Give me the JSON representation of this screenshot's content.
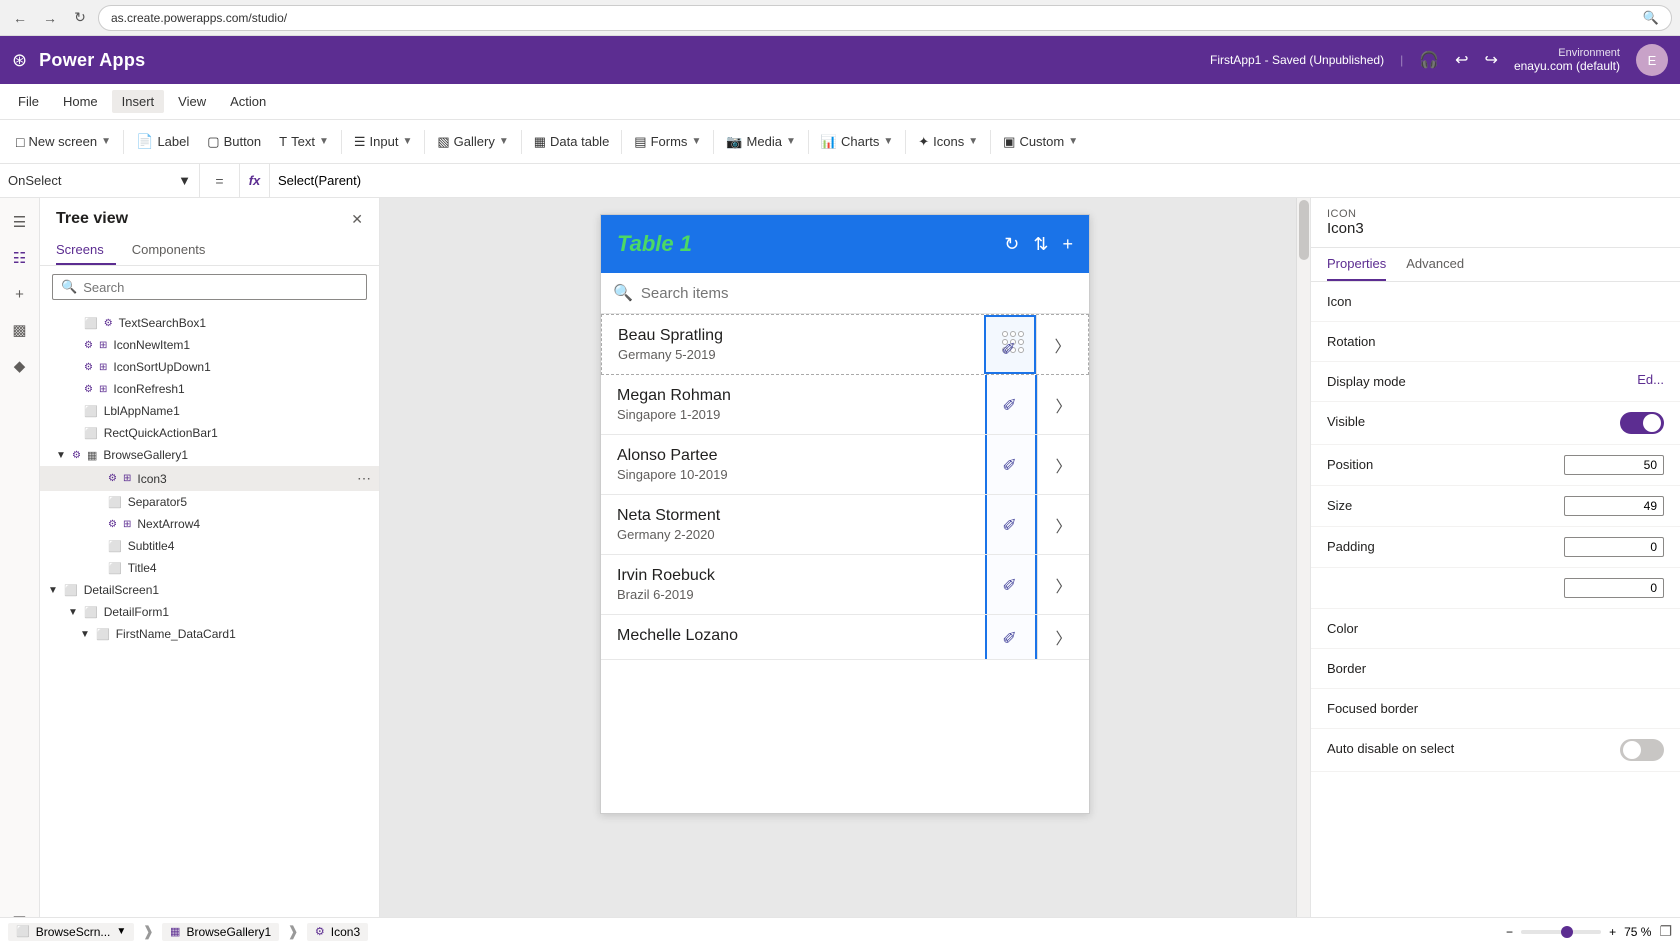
{
  "browser": {
    "url": "as.create.powerapps.com/studio/",
    "back_btn": "←",
    "forward_btn": "→",
    "refresh_btn": "↻"
  },
  "app_bar": {
    "grid_icon": "⊞",
    "title": "Power Apps",
    "env_label": "Environment",
    "env_name": "enayu.com (default)"
  },
  "menu": {
    "items": [
      "File",
      "Home",
      "Insert",
      "View",
      "Action"
    ],
    "active_item": "Insert",
    "save_status": "FirstApp1 - Saved (Unpublished)"
  },
  "toolbar": {
    "new_screen": "New screen",
    "label": "Label",
    "button": "Button",
    "text": "Text",
    "input": "Input",
    "gallery": "Gallery",
    "data_table": "Data table",
    "forms": "Forms",
    "media": "Media",
    "charts": "Charts",
    "icons": "Icons",
    "custom": "Custom"
  },
  "formula_bar": {
    "selector": "OnSelect",
    "equals": "=",
    "fx": "fx",
    "formula": "Select(Parent)"
  },
  "tree_view": {
    "title": "Tree view",
    "tabs": [
      "Screens",
      "Components"
    ],
    "active_tab": "Screens",
    "search_placeholder": "Search",
    "items": [
      {
        "id": "TextSearchBox1",
        "label": "TextSearchBox1",
        "indent": 2,
        "icon": "⬜",
        "type": "text"
      },
      {
        "id": "IconNewItem1",
        "label": "IconNewItem1",
        "indent": 2,
        "icon": "⊞",
        "type": "icon"
      },
      {
        "id": "IconSortUpDown1",
        "label": "IconSortUpDown1",
        "indent": 2,
        "icon": "⊞",
        "type": "icon"
      },
      {
        "id": "IconRefresh1",
        "label": "IconRefresh1",
        "indent": 2,
        "icon": "⊞",
        "type": "icon"
      },
      {
        "id": "LblAppName1",
        "label": "LblAppName1",
        "indent": 2,
        "icon": "⬜",
        "type": "label"
      },
      {
        "id": "RectQuickActionBar1",
        "label": "RectQuickActionBar1",
        "indent": 2,
        "icon": "⬜",
        "type": "rect"
      },
      {
        "id": "BrowseGallery1",
        "label": "BrowseGallery1",
        "indent": 1,
        "icon": "▦",
        "type": "gallery",
        "expanded": true
      },
      {
        "id": "Icon3",
        "label": "Icon3",
        "indent": 3,
        "icon": "⊞",
        "type": "icon",
        "selected": true
      },
      {
        "id": "Separator5",
        "label": "Separator5",
        "indent": 3,
        "icon": "⬜",
        "type": "separator"
      },
      {
        "id": "NextArrow4",
        "label": "NextArrow4",
        "indent": 3,
        "icon": "⊞",
        "type": "icon"
      },
      {
        "id": "Subtitle4",
        "label": "Subtitle4",
        "indent": 3,
        "icon": "⬜",
        "type": "label"
      },
      {
        "id": "Title4",
        "label": "Title4",
        "indent": 3,
        "icon": "⬜",
        "type": "label"
      },
      {
        "id": "DetailScreen1",
        "label": "DetailScreen1",
        "indent": 0,
        "icon": "⬜",
        "type": "screen",
        "expanded": true
      },
      {
        "id": "DetailForm1",
        "label": "DetailForm1",
        "indent": 1,
        "icon": "⬜",
        "type": "form",
        "expanded": true
      },
      {
        "id": "FirstName_DataCard1",
        "label": "FirstName_DataCard1",
        "indent": 2,
        "icon": "⬜",
        "type": "datacard",
        "expanded": true
      }
    ]
  },
  "canvas": {
    "title": "Table 1",
    "search_placeholder": "Search items",
    "gallery_items": [
      {
        "name": "Beau Spratling",
        "sub": "Germany 5-2019",
        "selected": true
      },
      {
        "name": "Megan Rohman",
        "sub": "Singapore 1-2019"
      },
      {
        "name": "Alonso Partee",
        "sub": "Singapore 10-2019"
      },
      {
        "name": "Neta Storment",
        "sub": "Germany 2-2020"
      },
      {
        "name": "Irvin Roebuck",
        "sub": "Brazil 6-2019"
      },
      {
        "name": "Mechelle Lozano",
        "sub": ""
      }
    ]
  },
  "right_panel": {
    "icon_section_label": "ICON",
    "icon_name": "Icon3",
    "tabs": [
      "Properties",
      "Advanced"
    ],
    "active_tab": "Properties",
    "properties": [
      {
        "label": "Icon",
        "value": ""
      },
      {
        "label": "Rotation",
        "value": ""
      },
      {
        "label": "Display mode",
        "value": "Ed..."
      },
      {
        "label": "Visible",
        "value": ""
      },
      {
        "label": "Position",
        "value": "50"
      },
      {
        "label": "Size",
        "value": "49"
      },
      {
        "label": "Padding",
        "value": "0"
      },
      {
        "label": "",
        "value": "0"
      },
      {
        "label": "Color",
        "value": ""
      },
      {
        "label": "Border",
        "value": ""
      },
      {
        "label": "Focused border",
        "value": ""
      },
      {
        "label": "Auto disable on select",
        "value": ""
      }
    ]
  },
  "bottom_bar": {
    "screens": [
      "BrowseScrn...",
      "BrowseGallery1",
      "Icon3"
    ],
    "zoom_minus": "−",
    "zoom_plus": "+",
    "zoom_level": "75 %"
  }
}
